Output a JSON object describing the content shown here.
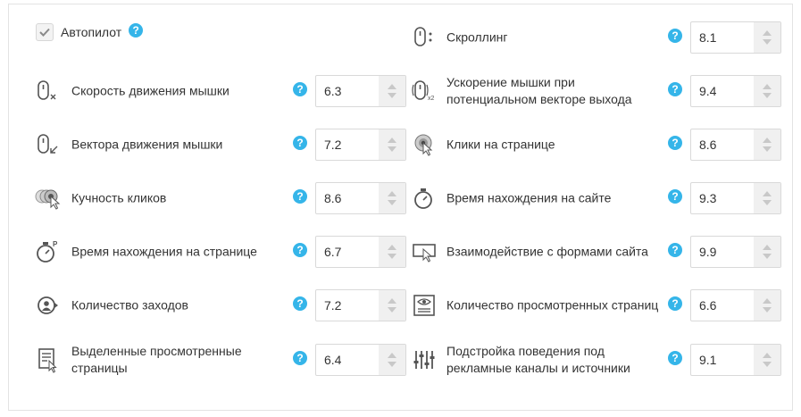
{
  "autopilot": {
    "label": "Автопилот",
    "checked": true
  },
  "left": [
    {
      "label": "Скорость движения мышки",
      "value": "6.3",
      "icon": "mouse-speed-icon"
    },
    {
      "label": "Вектора движения мышки",
      "value": "7.2",
      "icon": "mouse-vector-icon"
    },
    {
      "label": "Кучность кликов",
      "value": "8.6",
      "icon": "click-cluster-icon"
    },
    {
      "label": "Время нахождения на странице",
      "value": "6.7",
      "icon": "page-timer-icon"
    },
    {
      "label": "Количество заходов",
      "value": "7.2",
      "icon": "user-visits-icon"
    },
    {
      "label": "Выделенные просмотренные страницы",
      "value": "6.4",
      "icon": "page-select-icon"
    }
  ],
  "right": [
    {
      "label": "Скроллинг",
      "value": "8.1",
      "icon": "mouse-scroll-icon"
    },
    {
      "label": "Ускорение мышки при потенциальном векторе выхода",
      "value": "9.4",
      "icon": "mouse-acceleration-icon"
    },
    {
      "label": "Клики на странице",
      "value": "8.6",
      "icon": "page-clicks-icon"
    },
    {
      "label": "Время нахождения на сайте",
      "value": "9.3",
      "icon": "site-timer-icon"
    },
    {
      "label": "Взаимодействие с формами сайта",
      "value": "9.9",
      "icon": "form-interaction-icon"
    },
    {
      "label": "Количество просмотренных страниц",
      "value": "6.6",
      "icon": "pages-viewed-icon"
    },
    {
      "label": "Подстройка поведения под рекламные каналы и источники",
      "value": "9.1",
      "icon": "equalizer-icon"
    }
  ],
  "help_glyph": "?",
  "colors": {
    "help": "#35b5e9",
    "icon": "#555555",
    "border": "#d9d9d9"
  }
}
